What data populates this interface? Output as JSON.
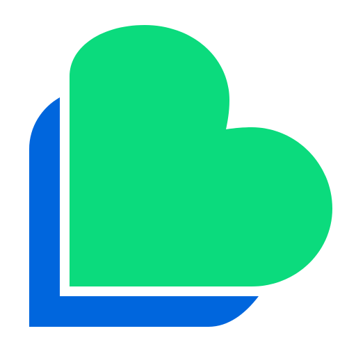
{
  "logo": {
    "icon": "heart-logo-icon",
    "colors": {
      "background": "#ffffff",
      "heart": "#0bdb7d",
      "back_shape": "#0066dd"
    }
  }
}
